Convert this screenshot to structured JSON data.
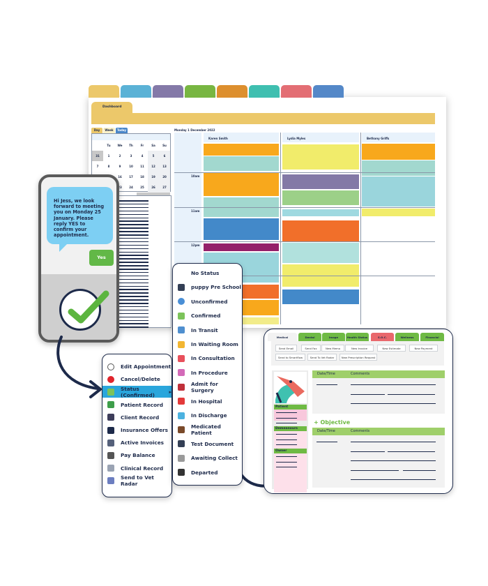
{
  "module_tab_colors": [
    "#ecc86a",
    "#5bb2d6",
    "#8479a8",
    "#78b642",
    "#dd8f2e",
    "#3fbfb0",
    "#e36e74",
    "#5488c8"
  ],
  "dashboard": {
    "tab_label": "Dashboard",
    "accent": "#ecc86a"
  },
  "calendar": {
    "view_tabs": [
      {
        "label": "Day"
      },
      {
        "label": "Week"
      },
      {
        "label": "Today"
      }
    ],
    "weekdays": [
      "",
      "Tu",
      "We",
      "Th",
      "Fr",
      "Sa",
      "Su"
    ],
    "weeks": [
      [
        "31",
        "1",
        "2",
        "3",
        "4",
        "5",
        "6"
      ],
      [
        "7",
        "8",
        "9",
        "10",
        "11",
        "12",
        "13"
      ],
      [
        "14",
        "15",
        "16",
        "17",
        "18",
        "19",
        "20"
      ],
      [
        "21",
        "22",
        "23",
        "24",
        "25",
        "26",
        "27"
      ],
      [
        "28",
        "29",
        "30",
        "31",
        "1",
        "2",
        "3"
      ]
    ]
  },
  "schedule": {
    "date": "Monday 1 December 2022",
    "times": [
      "10am",
      "11am",
      "12pm"
    ],
    "columns": [
      {
        "name": "Karen Smith",
        "appointment_colors": [
          "#f8a81c",
          "#a2d8cf",
          "#f8a81c",
          "#a2d8cf",
          "#4389c9",
          "#94216a",
          "#9ad5dc",
          "#f16f2a",
          "#f8a81c",
          "#f2ec8a"
        ]
      },
      {
        "name": "Lydia Myles",
        "appointment_colors": [
          "#f1ec6b",
          "#8379a6",
          "#9cd088",
          "#9fd9e0",
          "#f16f2a",
          "#b1e1dd",
          "#f1ec6b",
          "#4389c9"
        ]
      },
      {
        "name": "Bethany Griffs",
        "appointment_colors": [
          "#f8a81c",
          "#a2d8cf",
          "#9ad5dc",
          "#f1ec6b"
        ]
      }
    ]
  },
  "phone": {
    "message": "Hi Jess, we look forward to meeting you on Monday 25 January. Please reply YES to confirm your appointment.",
    "reply": "Yes",
    "icon": "check-circle-icon"
  },
  "context_menu": {
    "items": [
      {
        "label": "Edit Appointment",
        "icon": "clock-icon",
        "color": "#ffffff"
      },
      {
        "label": "Cancel/Delete",
        "icon": "no-entry-icon",
        "color": "#e0242c"
      },
      {
        "label": "Status (Confirmed)",
        "icon": "flag-icon",
        "color": "#7cc35a",
        "highlighted": true
      },
      {
        "label": "Patient Record",
        "icon": "dog-icon",
        "color": "#3e9e4a"
      },
      {
        "label": "Client Record",
        "icon": "person-icon",
        "color": "#3d3d5a"
      },
      {
        "label": "Insurance Offers",
        "icon": "shield-icon",
        "color": "#1d2a4a"
      },
      {
        "label": "Active Invoices",
        "icon": "invoice-icon",
        "color": "#55607a"
      },
      {
        "label": "Pay Balance",
        "icon": "money-bag-icon",
        "color": "#555555"
      },
      {
        "label": "Clinical Record",
        "icon": "stethoscope-icon",
        "color": "#9aa3b3"
      },
      {
        "label": "Send to Vet Radar",
        "icon": "radar-icon",
        "color": "#6c7ec0"
      }
    ]
  },
  "status_menu": {
    "items": [
      {
        "label": "No Status",
        "icon": "",
        "color": ""
      },
      {
        "label": "puppy Pre School",
        "icon": "ambulance-icon",
        "color": "#333f55"
      },
      {
        "label": "Unconfirmed",
        "icon": "info-icon",
        "color": "#4a8fd6"
      },
      {
        "label": "Confirmed",
        "icon": "flag-icon",
        "color": "#7cc35a"
      },
      {
        "label": "In Transit",
        "icon": "car-icon",
        "color": "#4f8fcf"
      },
      {
        "label": "In Waiting Room",
        "icon": "flag-icon",
        "color": "#f2b632"
      },
      {
        "label": "In Consultation",
        "icon": "flag-icon",
        "color": "#e8505b"
      },
      {
        "label": "In Procedure",
        "icon": "flag-icon",
        "color": "#d36ab8"
      },
      {
        "label": "Admit for Surgery",
        "icon": "scissors-icon",
        "color": "#c0303a"
      },
      {
        "label": "In Hospital",
        "icon": "hospital-flag-icon",
        "color": "#e33a3a"
      },
      {
        "label": "In Discharge",
        "icon": "flag-icon",
        "color": "#4cb2e0"
      },
      {
        "label": "Medicated Patient",
        "icon": "syringe-icon",
        "color": "#7a4a2a"
      },
      {
        "label": "Test Document",
        "icon": "ambulance-icon",
        "color": "#333f55"
      },
      {
        "label": "Awaiting Collect",
        "icon": "flag-icon",
        "color": "#9a9a9a"
      },
      {
        "label": "Departed",
        "icon": "checkered-flag-icon",
        "color": "#333333"
      }
    ]
  },
  "medical": {
    "tabs": [
      {
        "label": "Medical",
        "color": "#f2f2f2"
      },
      {
        "label": "Dental",
        "color": "#6fba44"
      },
      {
        "label": "Image",
        "color": "#6fba44"
      },
      {
        "label": "Health Status",
        "color": "#6fba44"
      },
      {
        "label": "S.O.C.",
        "color": "#e9686c"
      },
      {
        "label": "Wellness",
        "color": "#6fba44"
      },
      {
        "label": "Financial",
        "color": "#6fba44"
      }
    ],
    "buttons_row1": [
      "Send Email",
      "Send Fax",
      "New Memo",
      "New Invoice",
      "New Estimate",
      "New Payment"
    ],
    "buttons_row2": [
      "Send to Smartflow",
      "Send To Vet Radar",
      "New Prescription Request"
    ],
    "sidebar_sections": [
      "Patient",
      "Demeanours",
      "Owner"
    ],
    "table_headers": {
      "date": "Date/Time",
      "comments": "Comments"
    },
    "objective_heading": "+ Objective",
    "accent": "#9fcf6a"
  }
}
